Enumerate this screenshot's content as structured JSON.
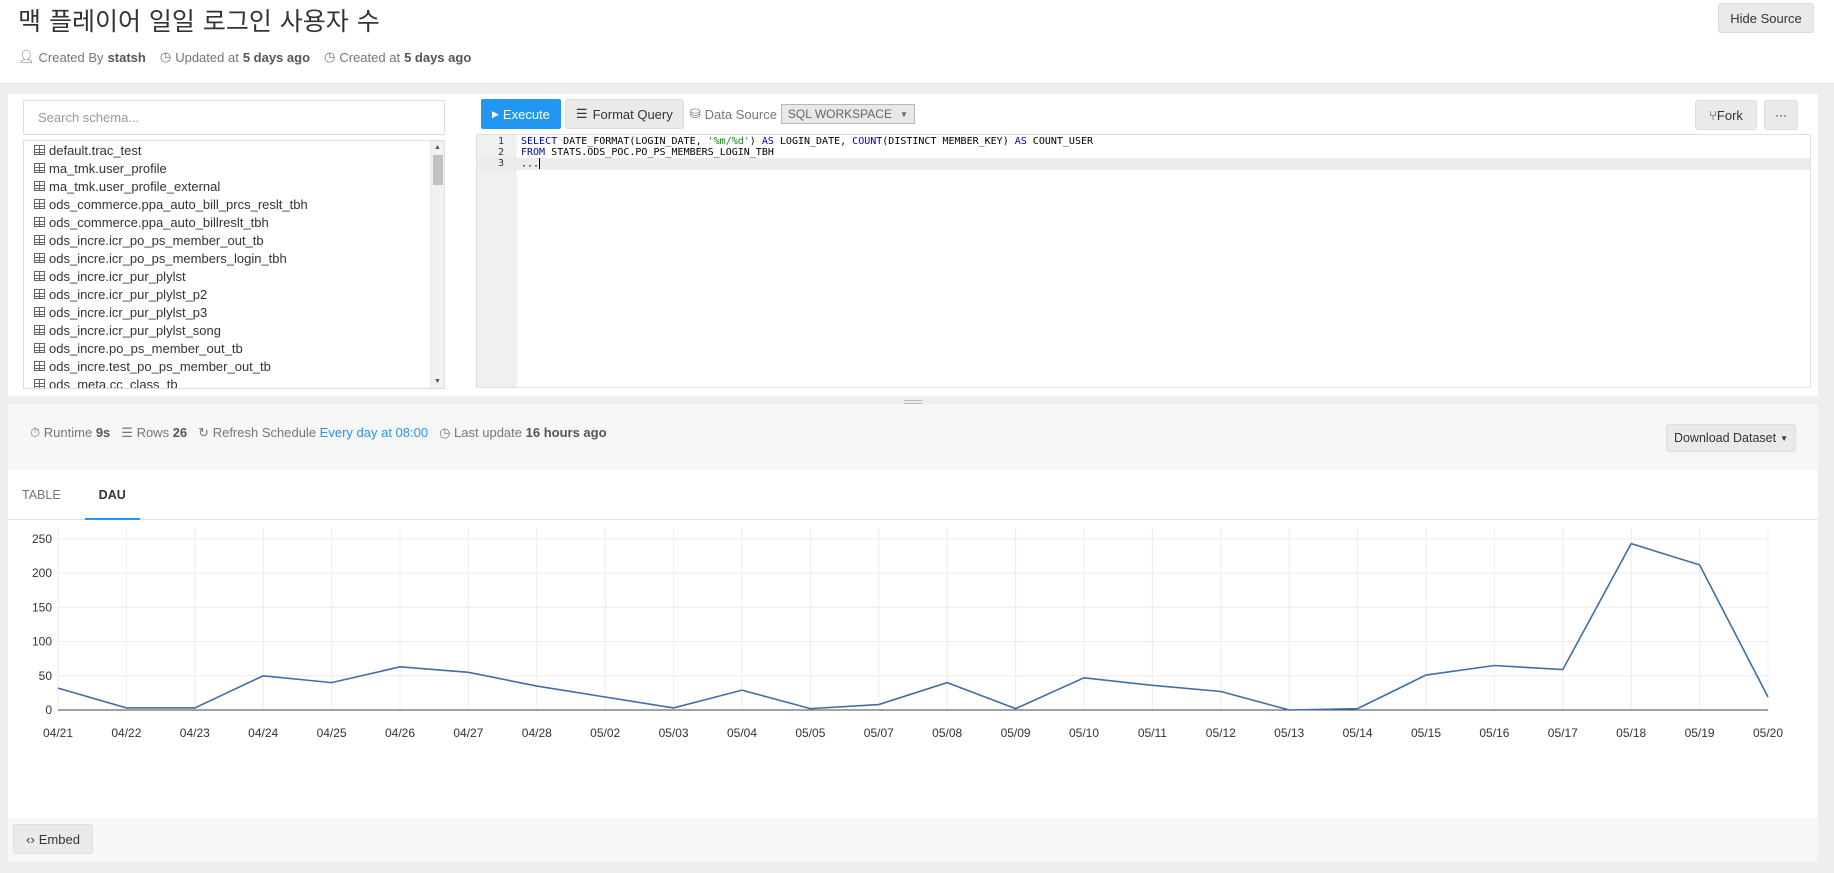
{
  "header": {
    "title": "맥 플레이어 일일 로그인 사용자 수",
    "created_by_label": "Created By",
    "created_by": "statsh",
    "updated_label": "Updated at",
    "updated_value": "5 days ago",
    "created_label": "Created at",
    "created_value": "5 days ago",
    "hide_source": "Hide Source"
  },
  "schema": {
    "search_placeholder": "Search schema...",
    "items": [
      "default.trac_test",
      "ma_tmk.user_profile",
      "ma_tmk.user_profile_external",
      "ods_commerce.ppa_auto_bill_prcs_reslt_tbh",
      "ods_commerce.ppa_auto_billreslt_tbh",
      "ods_incre.icr_po_ps_member_out_tb",
      "ods_incre.icr_po_ps_members_login_tbh",
      "ods_incre.icr_pur_plylst",
      "ods_incre.icr_pur_plylst_p2",
      "ods_incre.icr_pur_plylst_p3",
      "ods_incre.icr_pur_plylst_song",
      "ods_incre.po_ps_member_out_tb",
      "ods_incre.test_po_ps_member_out_tb",
      "ods_meta.cc_class_tb"
    ]
  },
  "toolbar": {
    "execute": "Execute",
    "format_query": "Format Query",
    "data_source_label": "Data Source",
    "data_source_value": "SQL WORKSPACE",
    "fork": "Fork",
    "more": "···"
  },
  "editor": {
    "line_numbers": [
      "1",
      "2",
      "3"
    ],
    "line1_kw1": "SELECT",
    "line1_a": " DATE_FORMAT(LOGIN_DATE, ",
    "line1_str": "'%m/%d'",
    "line1_b": ") ",
    "line1_kw2": "AS",
    "line1_c": " LOGIN_DATE, ",
    "line1_kw3": "COUNT",
    "line1_d": "(DISTINCT MEMBER_KEY) ",
    "line1_kw4": "AS",
    "line1_e": " COUNT_USER",
    "line2_kw": "FROM",
    "line2_rest": " STATS.ODS_POC.PO_PS_MEMBERS_LOGIN_TBH",
    "line3": "..."
  },
  "stats": {
    "runtime_label": "Runtime",
    "runtime_value": "9s",
    "rows_label": "Rows",
    "rows_value": "26",
    "refresh_label": "Refresh Schedule",
    "refresh_value": "Every day at 08:00",
    "last_update_label": "Last update",
    "last_update_value": "16 hours ago",
    "download": "Download Dataset"
  },
  "tabs": {
    "table": "TABLE",
    "dau": "DAU"
  },
  "embed": "Embed",
  "chart_data": {
    "type": "line",
    "categories": [
      "04/21",
      "04/22",
      "04/23",
      "04/24",
      "04/25",
      "04/26",
      "04/27",
      "04/28",
      "05/02",
      "05/03",
      "05/04",
      "05/05",
      "05/07",
      "05/08",
      "05/09",
      "05/10",
      "05/11",
      "05/12",
      "05/13",
      "05/14",
      "05/15",
      "05/16",
      "05/17",
      "05/18",
      "05/19",
      "05/20"
    ],
    "values": [
      32,
      3,
      3,
      50,
      40,
      63,
      55,
      35,
      19,
      3,
      29,
      2,
      8,
      40,
      2,
      47,
      36,
      27,
      0,
      2,
      51,
      65,
      59,
      243,
      212,
      19
    ],
    "y_ticks": [
      0,
      50,
      100,
      150,
      200,
      250
    ],
    "ylim": [
      0,
      260
    ],
    "grid": true,
    "line_color": "#3f6ea6"
  }
}
